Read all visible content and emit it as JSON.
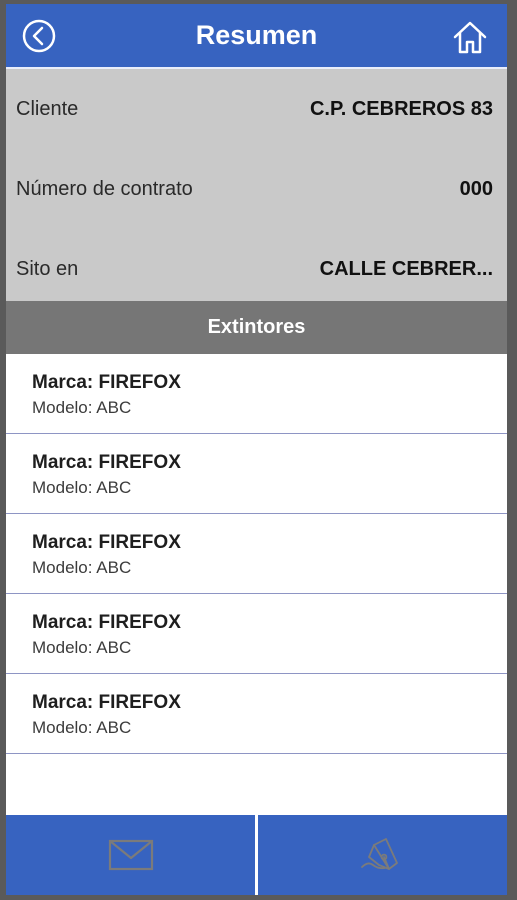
{
  "header": {
    "title": "Resumen",
    "back_icon": "back-circle-icon",
    "home_icon": "home-icon"
  },
  "summary": [
    {
      "label": "Cliente",
      "value": "C.P. CEBREROS 83"
    },
    {
      "label": "Número de contrato",
      "value": "000"
    },
    {
      "label": "Sito en",
      "value": "CALLE CEBRER..."
    }
  ],
  "section": {
    "title": "Extintores"
  },
  "extinguishers": [
    {
      "brand": "Marca: FIREFOX",
      "model": "Modelo: ABC"
    },
    {
      "brand": "Marca: FIREFOX",
      "model": "Modelo: ABC"
    },
    {
      "brand": "Marca: FIREFOX",
      "model": "Modelo: ABC"
    },
    {
      "brand": "Marca: FIREFOX",
      "model": "Modelo: ABC"
    },
    {
      "brand": "Marca: FIREFOX",
      "model": "Modelo: ABC"
    }
  ],
  "footer": {
    "left_icon": "mail-icon",
    "right_icon": "pen-sign-icon"
  },
  "colors": {
    "accent": "#3763c0",
    "info_background": "#c9c9c9",
    "section_background": "#767676",
    "divider": "#8e95c4"
  }
}
